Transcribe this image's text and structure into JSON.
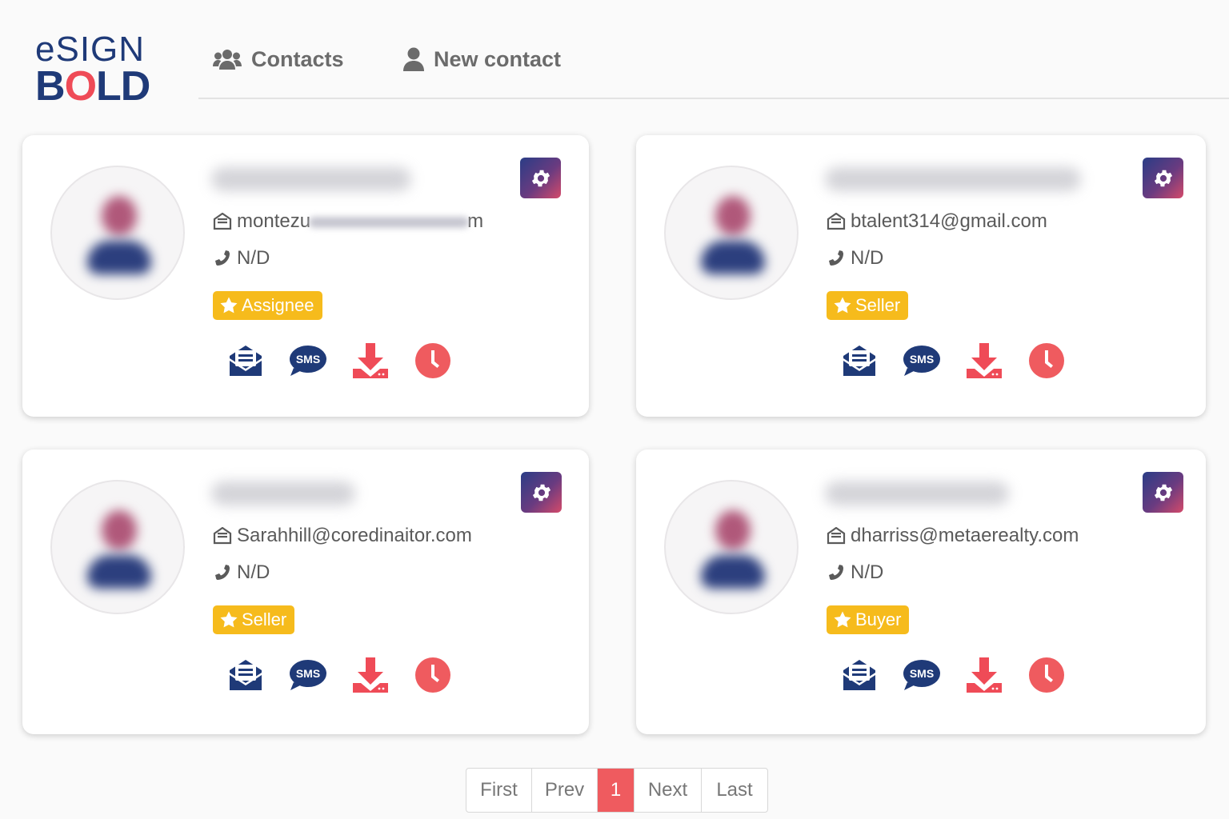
{
  "brand": {
    "line1": "eSIGN",
    "line2_a": "B",
    "line2_o": "O",
    "line2_b": "LD"
  },
  "nav": [
    {
      "label": "Contacts",
      "icon": "users-icon"
    },
    {
      "label": "New contact",
      "icon": "user-icon"
    }
  ],
  "contacts": [
    {
      "email_prefix": "montezu",
      "email_suffix": "m",
      "phone": "N/D",
      "role": "Assignee"
    },
    {
      "email": "btalent314@gmail.com",
      "phone": "N/D",
      "role": "Seller"
    },
    {
      "email": "Sarahhill@coredinaitor.com",
      "phone": "N/D",
      "role": "Seller"
    },
    {
      "email": "dharriss@metaerealty.com",
      "phone": "N/D",
      "role": "Buyer"
    }
  ],
  "actions": {
    "email": "email-icon",
    "sms_label": "SMS",
    "download": "download-icon",
    "history": "clock-icon"
  },
  "pagination": {
    "first": "First",
    "prev": "Prev",
    "current": "1",
    "next": "Next",
    "last": "Last"
  },
  "colors": {
    "brand_blue": "#1f3a78",
    "accent_red": "#ef4b57",
    "badge_yellow": "#f6bb1c"
  }
}
